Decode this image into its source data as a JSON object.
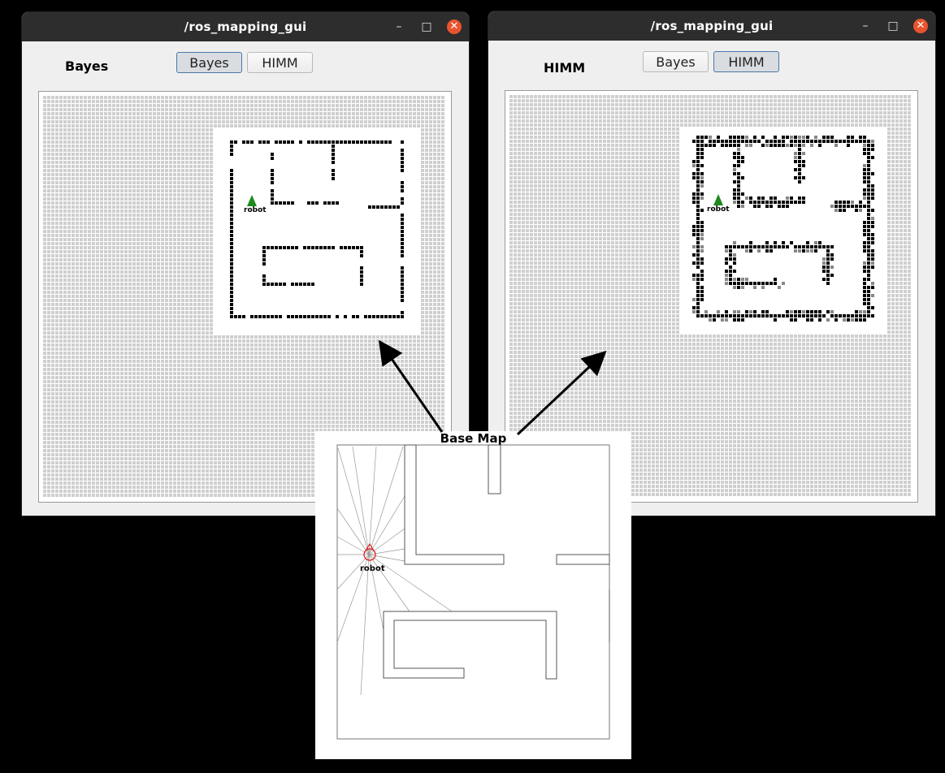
{
  "windows": [
    {
      "id": "bayes",
      "title": "/ros_mapping_gui",
      "mode_label": "Bayes",
      "buttons": [
        {
          "label": "Bayes",
          "active": true
        },
        {
          "label": "HIMM",
          "active": false
        }
      ],
      "robot_label": "robot"
    },
    {
      "id": "himm",
      "title": "/ros_mapping_gui",
      "mode_label": "HIMM",
      "buttons": [
        {
          "label": "Bayes",
          "active": false
        },
        {
          "label": "HIMM",
          "active": true
        }
      ],
      "robot_label": "robot"
    }
  ],
  "window_controls": {
    "minimize": "–",
    "maximize": "□",
    "close": "✕"
  },
  "base_map": {
    "title": "Base Map",
    "robot_label": "robot"
  },
  "colors": {
    "unknown_cell": "#cfcfcf",
    "free_cell": "#ffffff",
    "occupied_cell": "#000000",
    "robot_marker": "#1e8a1e",
    "close_button": "#e9542f"
  }
}
